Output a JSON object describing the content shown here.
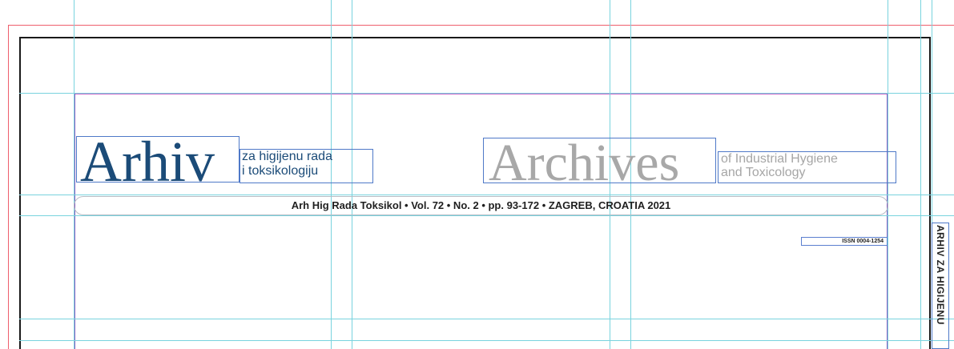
{
  "masthead": {
    "croatian_title": "Arhiv",
    "croatian_subtitle_line1": "za higijenu rada",
    "croatian_subtitle_line2": "i toksikologiju",
    "english_title": "Archives",
    "english_subtitle_line1": "of Industrial Hygiene",
    "english_subtitle_line2": "and Toxicology"
  },
  "citation": "Arh Hig Rada Toksikol • Vol. 72 • No. 2 • pp. 93-172 • ZAGREB, CROATIA 2021",
  "issn": "ISSN 0004-1254",
  "spine_text": "ARHIV ZA HIGIJENU",
  "colors": {
    "croatian_title": "#1b4b78",
    "english_title": "#a8a8a8",
    "guide": "#79d3de",
    "margin": "#c863c7",
    "bleed": "#ee5f6c",
    "frame": "#4f79c8"
  }
}
